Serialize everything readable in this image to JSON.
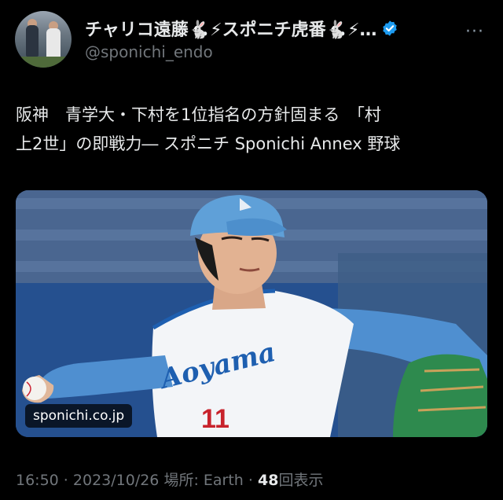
{
  "header": {
    "display_name": "チャリコ遠藤🐇⚡スポニチ虎番🐇⚡…",
    "handle": "@sponichi_endo",
    "more_label": "···",
    "verified_icon": "verified-badge-icon",
    "accent": "#1d9bf0"
  },
  "tweet": {
    "line1": "阪神　青学大・下村を1位指名の方針固まる　「村",
    "line2": "上2世」の即戦力― スポニチ Sponichi Annex 野球"
  },
  "media": {
    "domain": "sponichi.co.jp",
    "jersey_text": "Aoyama",
    "jersey_number": "11"
  },
  "meta": {
    "time": "16:50",
    "date": "2023/10/26",
    "location_label": "場所: Earth",
    "views_count": "48",
    "views_label": "回表示",
    "separator": " · "
  }
}
